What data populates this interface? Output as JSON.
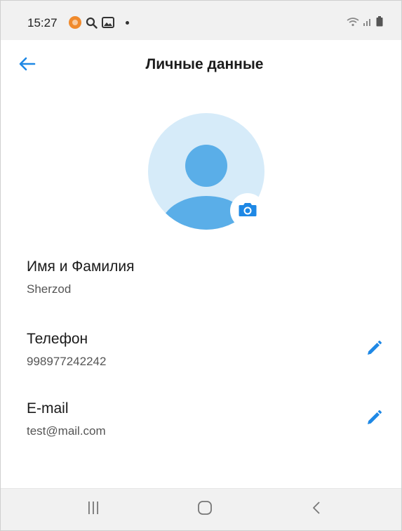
{
  "status_bar": {
    "time": "15:27",
    "icons_left": [
      "app-notification-icon",
      "search-icon",
      "gallery-icon",
      "more-dot-icon"
    ],
    "icons_right": [
      "wifi-icon",
      "signal-icon",
      "battery-icon"
    ]
  },
  "header": {
    "title": "Личные данные",
    "back_icon": "back-arrow-icon"
  },
  "avatar": {
    "camera_icon": "camera-icon"
  },
  "fields": [
    {
      "label": "Имя и Фамилия",
      "value": "Sherzod",
      "editable": false
    },
    {
      "label": "Телефон",
      "value": "998977242242",
      "editable": true
    },
    {
      "label": "E-mail",
      "value": "test@mail.com",
      "editable": true
    }
  ],
  "nav_bar": {
    "buttons": [
      "recent-apps-icon",
      "home-icon",
      "back-icon"
    ]
  },
  "colors": {
    "accent": "#1e88e5",
    "avatar_bg": "#d6ebf9",
    "avatar_fg": "#5aaee8",
    "bar_bg": "#f1f1f1"
  }
}
